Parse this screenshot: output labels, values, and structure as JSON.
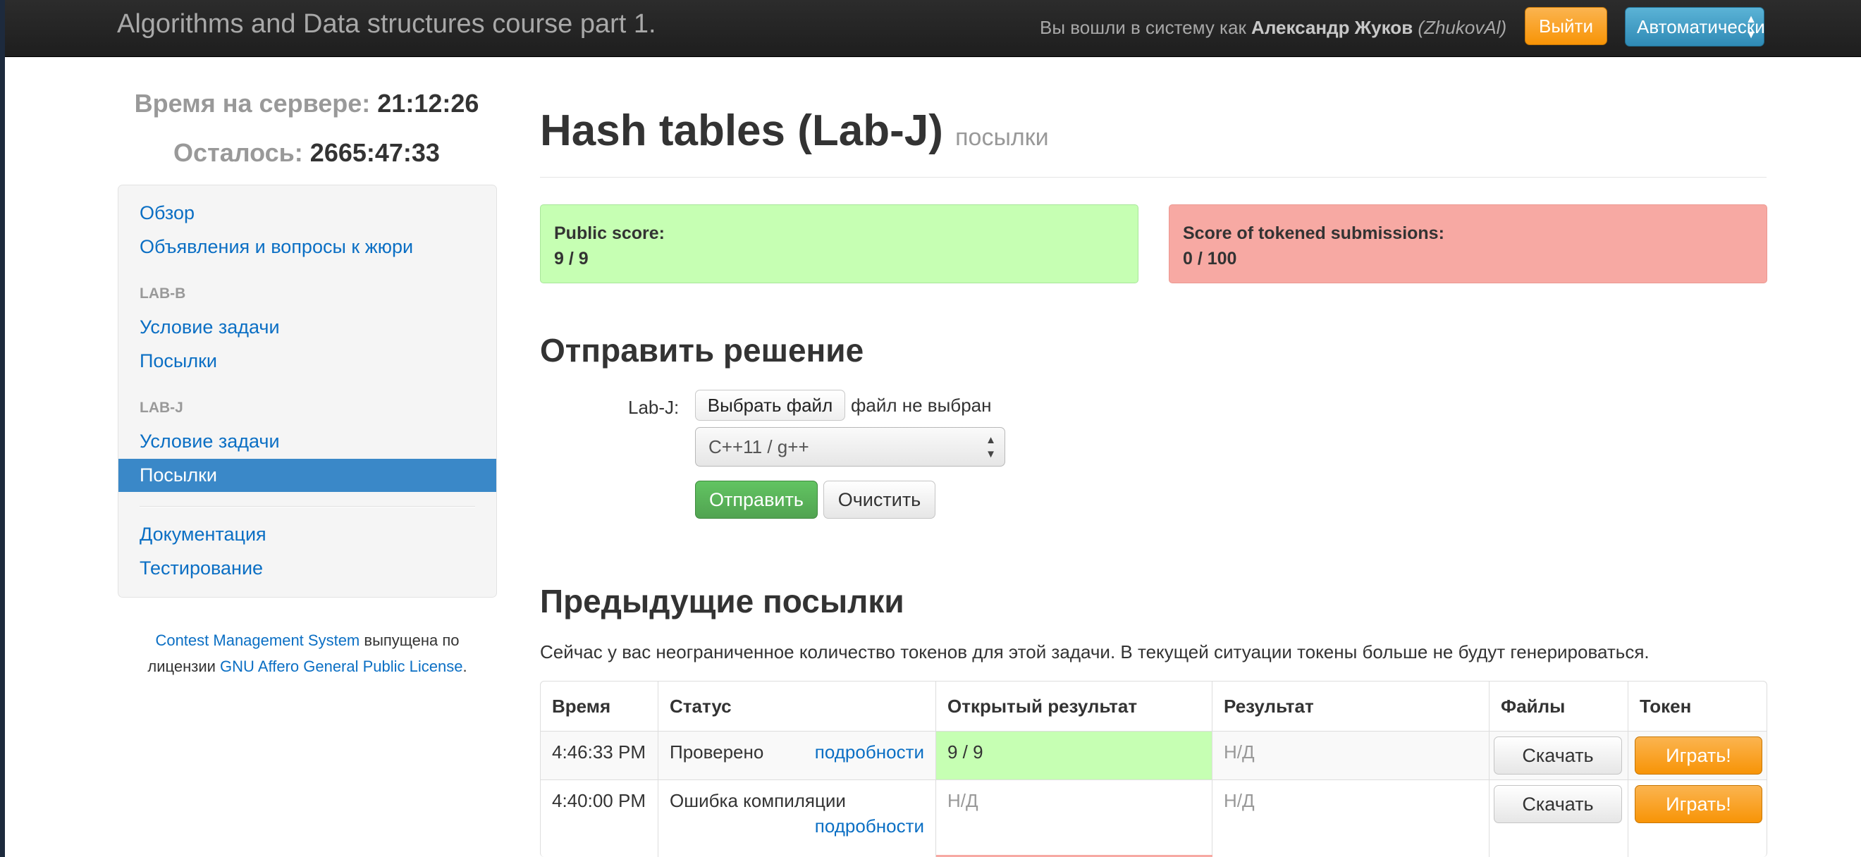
{
  "navbar": {
    "brand": "Algorithms and Data structures course part 1.",
    "login_prefix": "Вы вошли в систему как ",
    "user_name": "Александр Жуков",
    "user_login": "(ZhukovAl)",
    "logout_label": "Выйти",
    "language_label": "Автоматически"
  },
  "clock": {
    "server_time_label": "Время на сервере:",
    "server_time_value": "21:12:26",
    "remaining_label": "Осталось:",
    "remaining_value": "2665:47:33"
  },
  "sidebar": {
    "overview": "Обзор",
    "announcements": "Объявления и вопросы к жюри",
    "lab_b_header": "LAB-B",
    "lab_b_statement": "Условие задачи",
    "lab_b_submissions": "Посылки",
    "lab_j_header": "LAB-J",
    "lab_j_statement": "Условие задачи",
    "lab_j_submissions": "Посылки",
    "documentation": "Документация",
    "testing": "Тестирование"
  },
  "footer": {
    "cms_link": "Contest Management System",
    "text1": " выпущена по",
    "text2": "лицензии ",
    "license_link": "GNU Affero General Public License",
    "text3": "."
  },
  "page": {
    "title": "Hash tables (Lab-J)",
    "subtitle": "посылки"
  },
  "scores": {
    "public_label": "Public score:",
    "public_value": "9 / 9",
    "tokened_label": "Score of tokened submissions:",
    "tokened_value": "0 / 100"
  },
  "submit_form": {
    "heading": "Отправить решение",
    "file_label": "Lab-J:",
    "choose_file": "Выбрать файл",
    "no_file": "файл не выбран",
    "compiler": "C++11 / g++",
    "submit": "Отправить",
    "reset": "Очистить"
  },
  "previous": {
    "heading": "Предыдущие посылки",
    "tokens_info": "Сейчас у вас неограниченное количество токенов для этой задачи. В текущей ситуации токены больше не будут генерироваться.",
    "headers": [
      "Время",
      "Статус",
      "Открытый результат",
      "Результат",
      "Файлы",
      "Токен"
    ],
    "rows": [
      {
        "time": "4:46:33 PM",
        "status": "Проверено",
        "details": "подробности",
        "public_result": "9 / 9",
        "result": "Н/Д",
        "download": "Скачать",
        "play": "Играть!"
      },
      {
        "time": "4:40:00 PM",
        "status": "Ошибка компиляции",
        "details": "подробности",
        "public_result": "Н/Д",
        "result": "Н/Д",
        "download": "Скачать",
        "play": "Играть!"
      }
    ]
  },
  "colors": {
    "navbar_bg": "#222222",
    "link": "#0b6fc4",
    "active_nav": "#3a88c8",
    "success_bg": "#c6ffb3",
    "danger_bg": "#f7a9a3",
    "warning_btn": "#f89406",
    "success_btn": "#51a351"
  }
}
